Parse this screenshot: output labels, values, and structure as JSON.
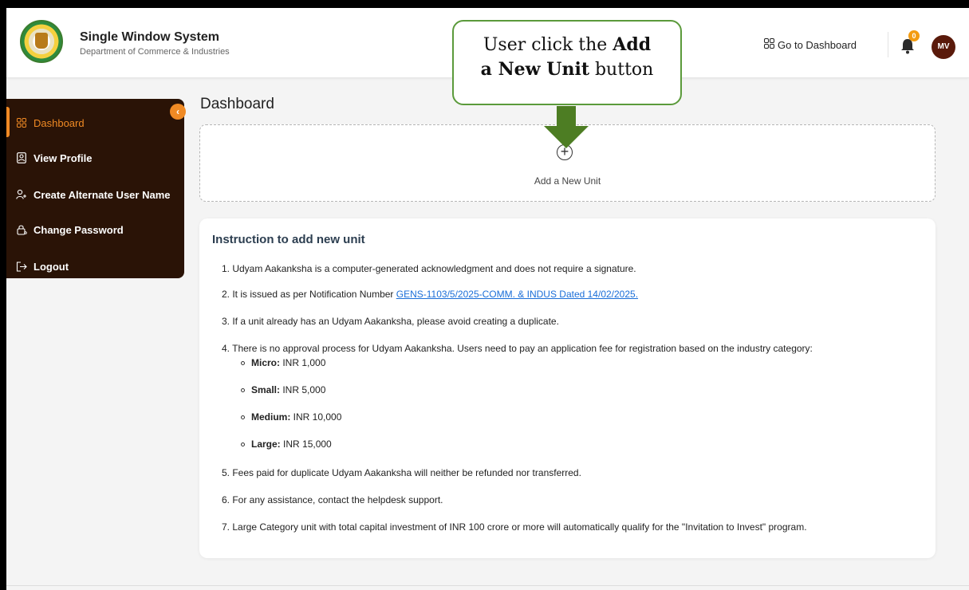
{
  "header": {
    "brand_title": "Single Window System",
    "brand_subtitle": "Department of Commerce & Industries",
    "goto_dashboard": "Go to Dashboard",
    "notification_count": "0",
    "avatar_initials": "MV"
  },
  "sidebar": {
    "items": [
      {
        "label": "Dashboard",
        "icon": "grid-icon",
        "active": true
      },
      {
        "label": "View Profile",
        "icon": "profile-doc-icon"
      },
      {
        "label": "Create Alternate User Name",
        "icon": "user-add-icon"
      },
      {
        "label": "Change Password",
        "icon": "lock-icon"
      },
      {
        "label": "Logout",
        "icon": "logout-icon"
      }
    ]
  },
  "main": {
    "title": "Dashboard",
    "add_unit_label": "Add a New Unit",
    "instructions": {
      "title": "Instruction to add new unit",
      "items": [
        "1. Udyam Aakanksha is a computer-generated acknowledgment and does not require a signature.",
        "2. It is issued as per Notification Number ",
        "3. If a unit already has an Udyam Aakanksha, please avoid creating a duplicate.",
        "4. There is no approval process for Udyam Aakanksha. Users need to pay an application fee for registration based on the industry category:",
        "5. Fees paid for duplicate Udyam Aakanksha will neither be refunded nor transferred.",
        "6. For any assistance, contact the helpdesk support.",
        "7. Large Category unit with total capital investment of INR 100 crore or more will automatically qualify for the \"Invitation to Invest\" program."
      ],
      "notification_link": "GENS-1103/5/2025-COMM. & INDUS Dated 14/02/2025.",
      "fees": [
        {
          "category": "Micro:",
          "amount": " INR 1,000"
        },
        {
          "category": "Small:",
          "amount": " INR 5,000"
        },
        {
          "category": "Medium:",
          "amount": " INR 10,000"
        },
        {
          "category": "Large:",
          "amount": " INR 15,000"
        }
      ]
    }
  },
  "callout": {
    "line1_pre": "User click the ",
    "line1_bold": "Add",
    "line2_bold": "a New Unit",
    "line2_post": " button"
  },
  "colors": {
    "accent": "#f08a24",
    "sidebar_bg": "#2a1306",
    "callout_border": "#5b9a3b",
    "arrow": "#4d7d23",
    "link": "#1a6ed8"
  }
}
